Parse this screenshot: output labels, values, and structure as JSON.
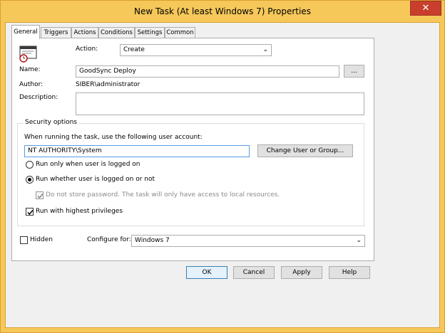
{
  "window": {
    "title": "New Task (At least Windows 7) Properties",
    "close_glyph": "✕"
  },
  "tabs": [
    {
      "label": "General",
      "active": true
    },
    {
      "label": "Triggers"
    },
    {
      "label": "Actions"
    },
    {
      "label": "Conditions"
    },
    {
      "label": "Settings"
    },
    {
      "label": "Common"
    }
  ],
  "general": {
    "task_icon": "scheduled-task-icon",
    "action_label": "Action:",
    "action_value": "Create",
    "name_label": "Name:",
    "name_value": "GoodSync Deploy",
    "browse_label": "...",
    "author_label": "Author:",
    "author_value": "SIBER\\administrator",
    "description_label": "Description:",
    "description_value": ""
  },
  "security": {
    "group_title": "Security options",
    "account_prompt": "When running the task, use the following user account:",
    "account_value": "NT AUTHORITY\\System",
    "change_button": "Change User or Group...",
    "radio_logged_on": "Run only when user is logged on",
    "radio_whether": "Run whether user is logged on or not",
    "no_store_password": "Do not store password.  The task will only have access to local resources.",
    "highest_privileges": "Run with highest privileges"
  },
  "bottom": {
    "hidden_label": "Hidden",
    "configure_label": "Configure for:",
    "configure_value": "Windows 7"
  },
  "buttons": {
    "ok": "OK",
    "cancel": "Cancel",
    "apply": "Apply",
    "help": "Help"
  }
}
